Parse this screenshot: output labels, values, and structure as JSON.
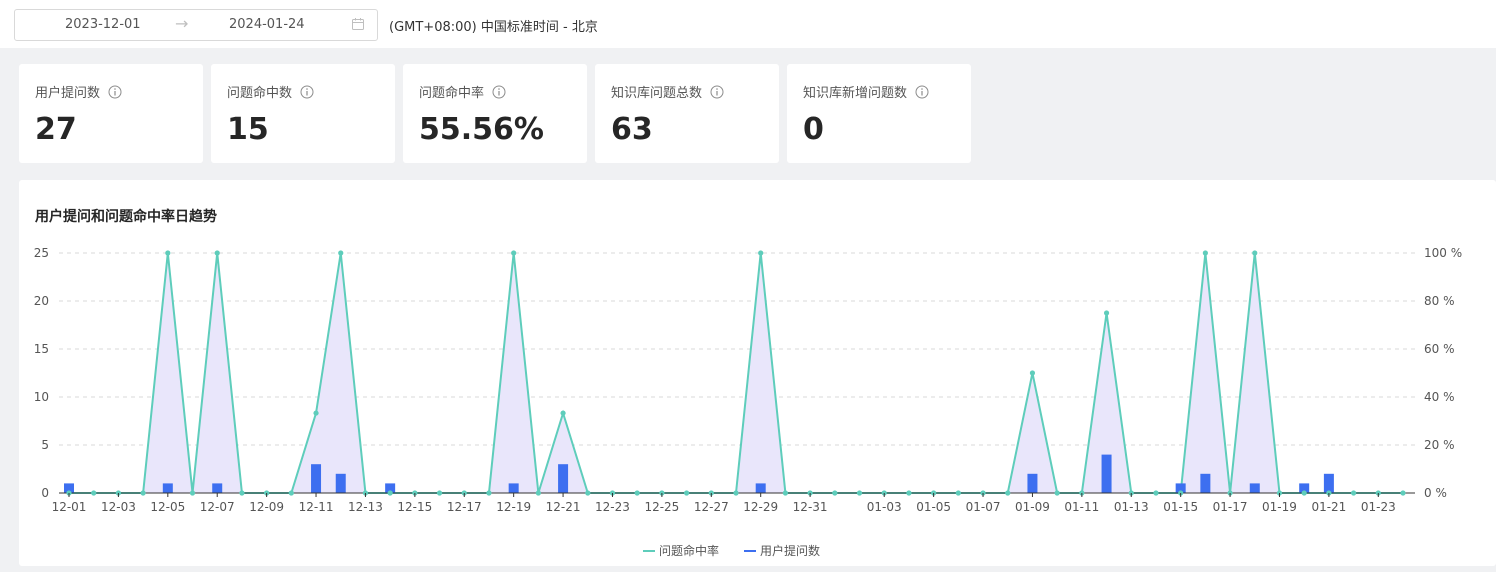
{
  "date_range": {
    "start": "2023-12-01",
    "end": "2024-01-24"
  },
  "timezone": "(GMT+08:00) 中国标准时间 - 北京",
  "metrics": [
    {
      "label": "用户提问数",
      "value": "27"
    },
    {
      "label": "问题命中数",
      "value": "15"
    },
    {
      "label": "问题命中率",
      "value": "55.56%"
    },
    {
      "label": "知识库问题总数",
      "value": "63"
    },
    {
      "label": "知识库新增问题数",
      "value": "0"
    }
  ],
  "chart_title": "用户提问和问题命中率日趋势",
  "chart_data": {
    "type": "bar",
    "title": "用户提问和问题命中率日趋势",
    "x": [
      "12-01",
      "12-02",
      "12-03",
      "12-04",
      "12-05",
      "12-06",
      "12-07",
      "12-08",
      "12-09",
      "12-10",
      "12-11",
      "12-12",
      "12-13",
      "12-14",
      "12-15",
      "12-16",
      "12-17",
      "12-18",
      "12-19",
      "12-20",
      "12-21",
      "12-22",
      "12-23",
      "12-24",
      "12-25",
      "12-26",
      "12-27",
      "12-28",
      "12-29",
      "12-30",
      "12-31",
      "01-01",
      "01-02",
      "01-03",
      "01-04",
      "01-05",
      "01-06",
      "01-07",
      "01-08",
      "01-09",
      "01-10",
      "01-11",
      "01-12",
      "01-13",
      "01-14",
      "01-15",
      "01-16",
      "01-17",
      "01-18",
      "01-19",
      "01-20",
      "01-21",
      "01-22",
      "01-23",
      "01-24"
    ],
    "x_tick_labels": [
      "12-01",
      "12-03",
      "12-05",
      "12-07",
      "12-09",
      "12-11",
      "12-13",
      "12-15",
      "12-17",
      "12-19",
      "12-21",
      "12-23",
      "12-25",
      "12-27",
      "12-29",
      "12-31",
      "01-03",
      "01-05",
      "01-07",
      "01-09",
      "01-11",
      "01-13",
      "01-15",
      "01-17",
      "01-19",
      "01-21",
      "01-23"
    ],
    "y_left": {
      "ticks": [
        "0",
        "5",
        "10",
        "15",
        "20",
        "25"
      ],
      "lim": [
        0,
        25
      ]
    },
    "y_right": {
      "ticks": [
        "0 %",
        "20 %",
        "40 %",
        "60 %",
        "80 %",
        "100 %"
      ],
      "lim": [
        0,
        100
      ]
    },
    "grid": true,
    "legend_position": "bottom-center",
    "series": [
      {
        "name": "问题命中率",
        "type": "area-line",
        "axis": "right",
        "color": "#5ecdbb",
        "fill": "#e9e6fb",
        "values": [
          0,
          0,
          0,
          0,
          100,
          0,
          100,
          0,
          0,
          0,
          33.3,
          100,
          0,
          0,
          0,
          0,
          0,
          0,
          100,
          0,
          33.3,
          0,
          0,
          0,
          0,
          0,
          0,
          0,
          100,
          0,
          0,
          0,
          0,
          0,
          0,
          0,
          0,
          0,
          0,
          50,
          0,
          0,
          75,
          0,
          0,
          0,
          100,
          0,
          100,
          0,
          0,
          0,
          0,
          0,
          0
        ]
      },
      {
        "name": "用户提问数",
        "type": "bar",
        "axis": "left",
        "color": "#3d6ff0",
        "values": [
          1,
          0,
          0,
          0,
          1,
          0,
          1,
          0,
          0,
          0,
          3,
          2,
          0,
          1,
          0,
          0,
          0,
          0,
          1,
          0,
          3,
          0,
          0,
          0,
          0,
          0,
          0,
          0,
          1,
          0,
          0,
          0,
          0,
          0,
          0,
          0,
          0,
          0,
          0,
          2,
          0,
          0,
          4,
          0,
          0,
          1,
          2,
          0,
          1,
          0,
          1,
          2,
          0,
          0,
          0
        ]
      }
    ]
  }
}
